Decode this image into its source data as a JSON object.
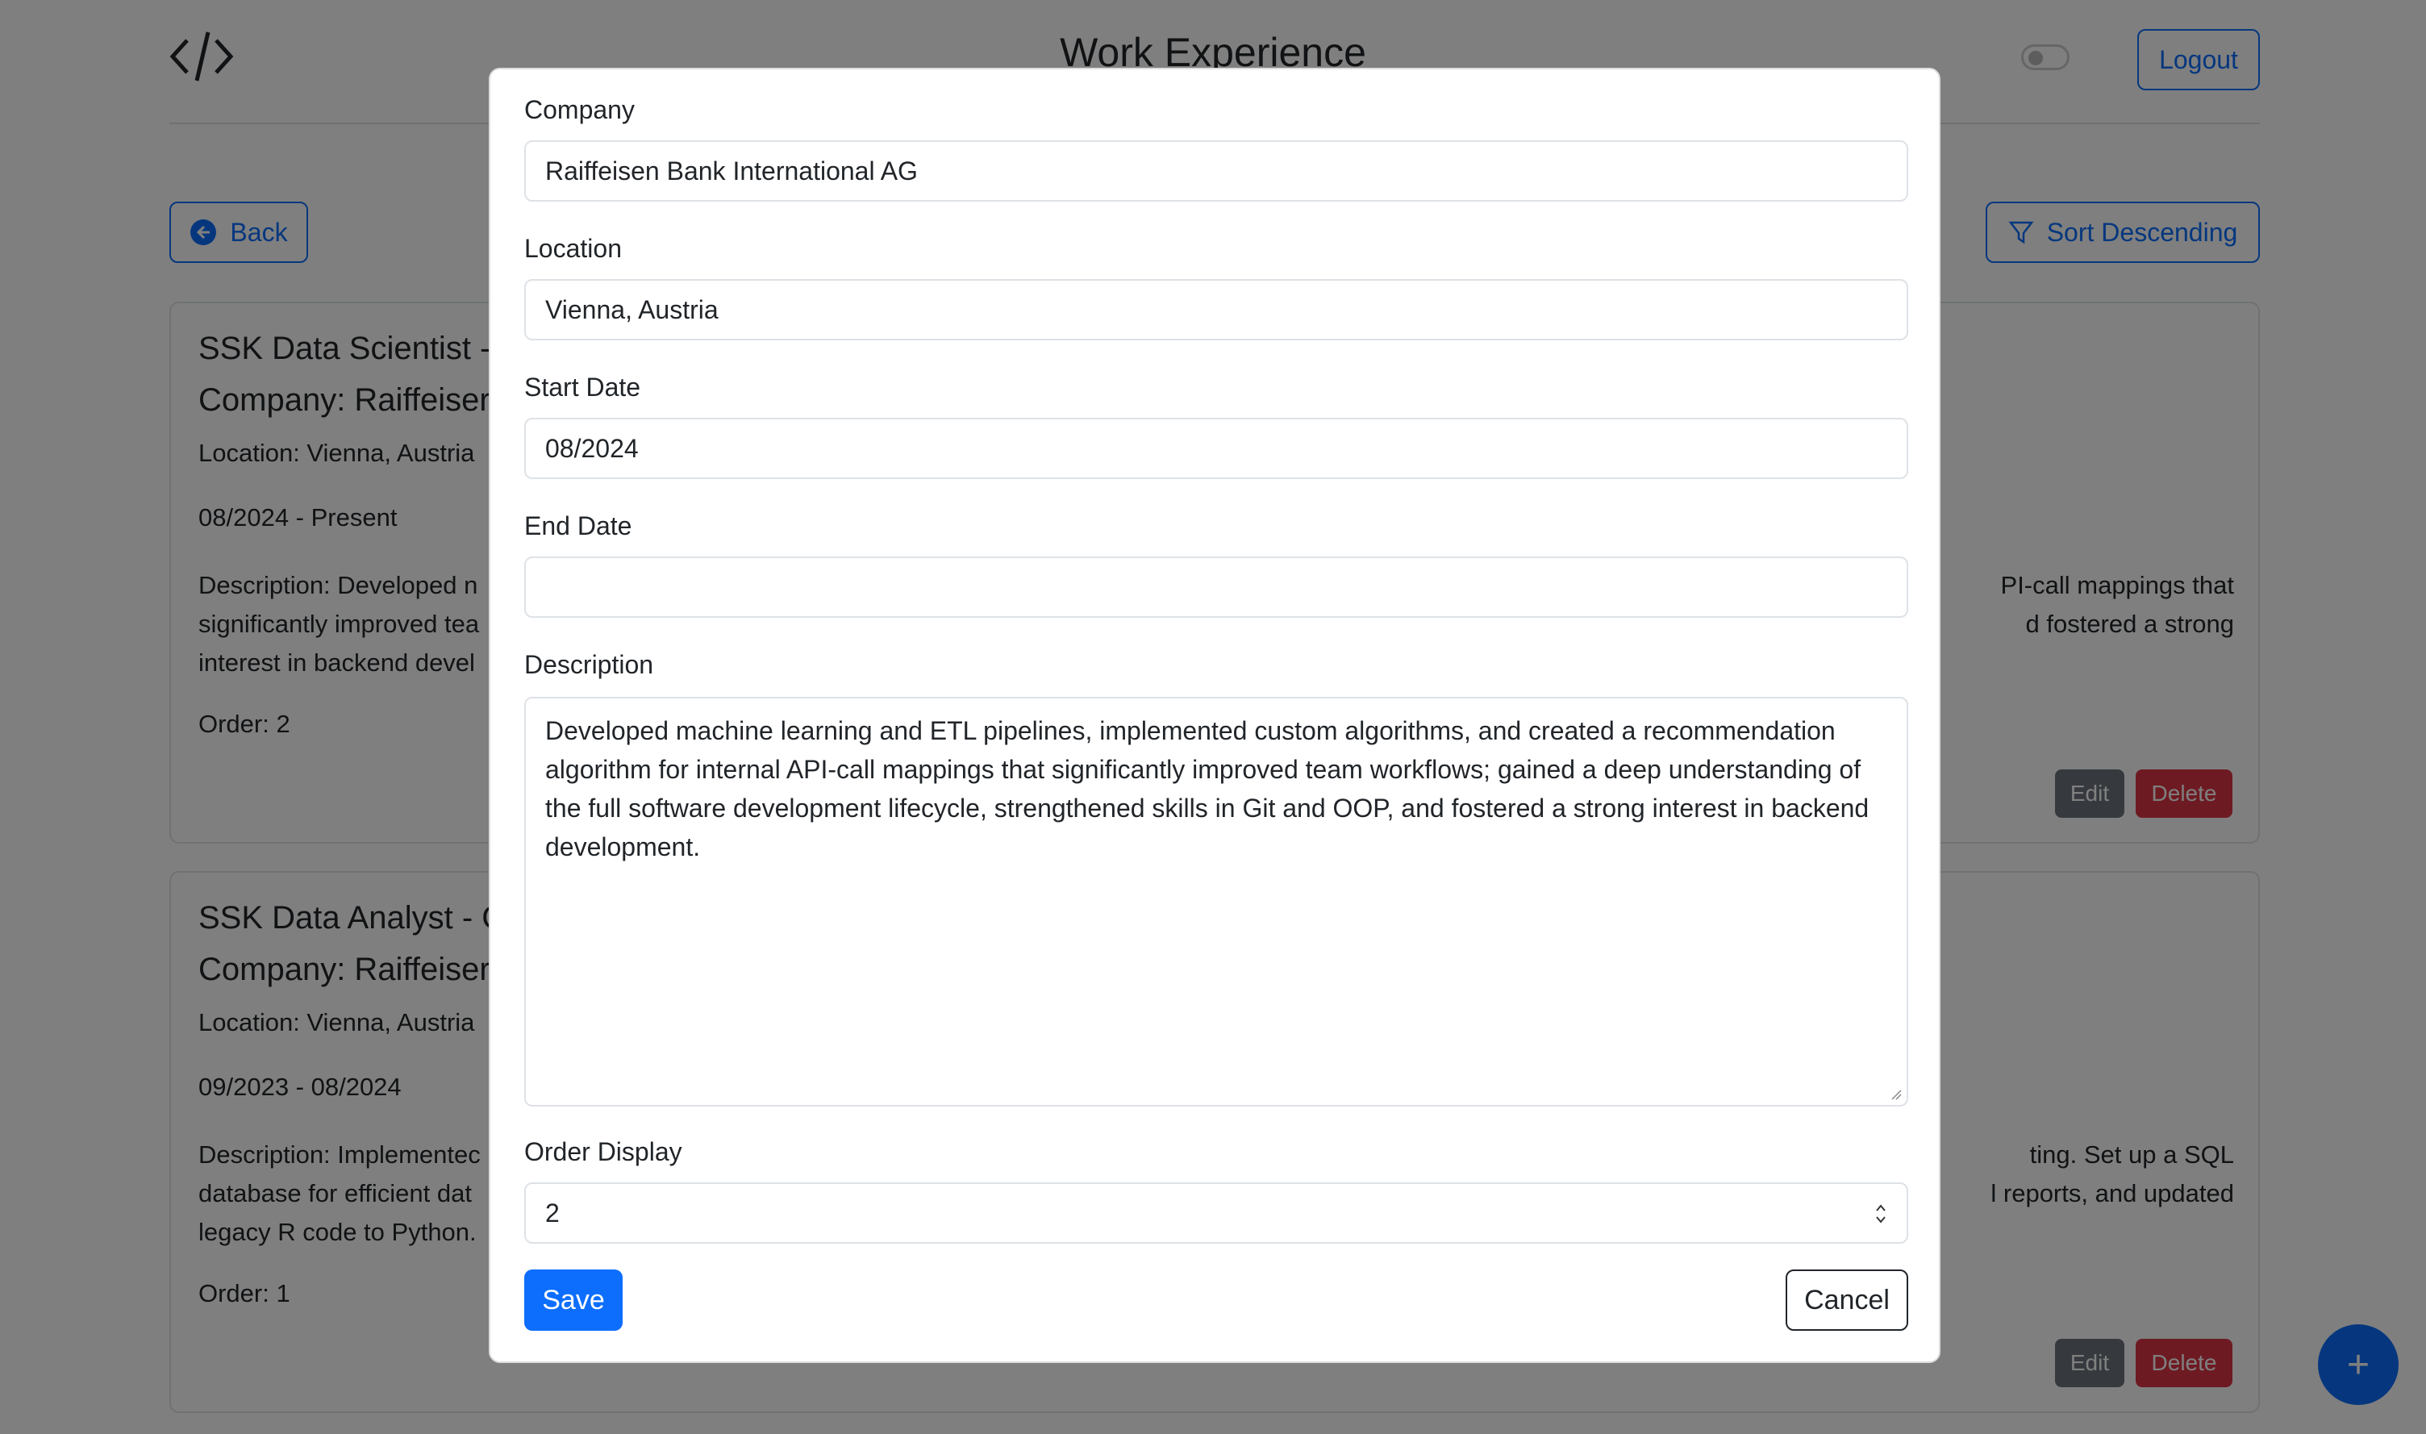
{
  "header": {
    "title": "Work Experience",
    "logout_label": "Logout"
  },
  "toolbar": {
    "back_label": "Back",
    "sort_label": "Sort Descending"
  },
  "cards": [
    {
      "title": "SSK Data Scientist -",
      "company": "Company: Raiffeiser",
      "location": "Location: Vienna, Austria",
      "dates": "08/2024 - Present",
      "description_left": "Description: Developed n",
      "description_line2_left": "significantly improved tea",
      "description_line3_left": "interest in backend devel",
      "description_right1": "PI-call mappings that",
      "description_right2": "d fostered a strong",
      "order": "Order: 2",
      "edit_label": "Edit",
      "delete_label": "Delete"
    },
    {
      "title": "SSK Data Analyst - C",
      "company": "Company: Raiffeiser",
      "location": "Location: Vienna, Austria",
      "dates": "09/2023 - 08/2024",
      "description_left": "Description: Implementec",
      "description_line2_left": "database for efficient dat",
      "description_line3_left": "legacy R code to Python.",
      "description_right1": "ting. Set up a SQL",
      "description_right2": "l reports, and updated",
      "order": "Order: 1",
      "edit_label": "Edit",
      "delete_label": "Delete"
    }
  ],
  "fab": {
    "label": "+"
  },
  "modal": {
    "company_label": "Company",
    "company_value": "Raiffeisen Bank International AG",
    "location_label": "Location",
    "location_value": "Vienna, Austria",
    "start_label": "Start Date",
    "start_value": "08/2024",
    "end_label": "End Date",
    "end_value": "",
    "description_label": "Description",
    "description_value": "Developed machine learning and ETL pipelines, implemented custom algorithms, and created a recommendation algorithm for internal API-call mappings that significantly improved team workflows; gained a deep understanding of the full software development lifecycle, strengthened skills in Git and OOP, and fostered a strong interest in backend development.",
    "order_label": "Order Display",
    "order_value": "2",
    "save_label": "Save",
    "cancel_label": "Cancel"
  },
  "colors": {
    "primary": "#0d6efd",
    "danger": "#dc3545",
    "secondary": "#6c757d"
  }
}
